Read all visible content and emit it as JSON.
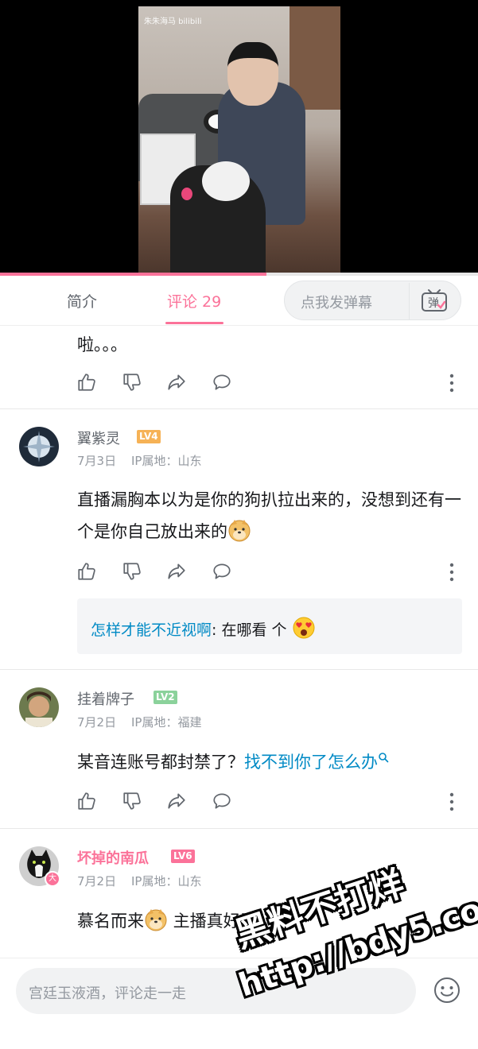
{
  "video": {
    "watermark_text": "朱朱海马 bilibili",
    "progress_fraction": 0.557
  },
  "tabs": {
    "intro_label": "简介",
    "comments_label": "评论 29"
  },
  "danmaku": {
    "placeholder": "点我发弹幕",
    "icon_label": "弹"
  },
  "comments": [
    {
      "partial_text": "啦。。。"
    },
    {
      "username": "翼紫灵",
      "level": "LV4",
      "level_color": "#f6b256",
      "date": "7月3日",
      "location": "IP属地：山东",
      "text": "直播漏胸本以为是你的狗扒拉出来的，没想到还有一个是你自己放出来的",
      "reply": {
        "user": "怎样才能不近视啊",
        "text": ": 在哪看 个"
      }
    },
    {
      "username": "挂着牌子",
      "level": "LV2",
      "level_color": "#8bd29b",
      "date": "7月2日",
      "location": "IP属地：福建",
      "text": "某音连账号都封禁了？",
      "link_text": "找不到你了怎么办"
    },
    {
      "username": "坏掉的南瓜",
      "level": "LV6",
      "level_color": "#fb7299",
      "badge": "大",
      "date": "7月2日",
      "location": "IP属地：山东",
      "text_before": "慕名而来",
      "text_after": " 主播真好看"
    }
  ],
  "bottom_bar": {
    "input_placeholder": "宫廷玉液酒，评论走一走"
  },
  "site_watermark": {
    "line1": "黑料不打烊",
    "line2": "http://bdy5.co"
  },
  "colors": {
    "accent": "#fb7299",
    "link": "#008ac5"
  }
}
